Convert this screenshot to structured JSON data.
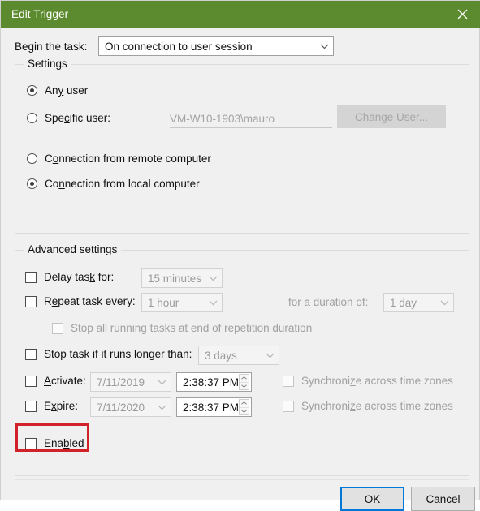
{
  "window": {
    "title": "Edit Trigger",
    "titlebar_color": "#5c8a2e",
    "close_icon": "close-icon"
  },
  "begin_task": {
    "label": "Begin the task:",
    "value": "On connection to user session"
  },
  "settings_group": {
    "title": "Settings",
    "radios": [
      {
        "label_pre": "An",
        "label_accel": "y",
        "label_post": " user",
        "checked": true
      },
      {
        "label_pre": "Spe",
        "label_accel": "c",
        "label_post": "ific user:",
        "checked": false
      },
      {
        "label_pre": "C",
        "label_accel": "o",
        "label_post": "nnection from remote computer",
        "checked": false
      },
      {
        "label_pre": "Co",
        "label_accel": "n",
        "label_post": "nection from local computer",
        "checked": true
      }
    ],
    "specific_user_value": "VM-W10-1903\\mauro",
    "change_user_button": {
      "pre": "Change ",
      "accel": "U",
      "post": "ser...",
      "enabled": false
    }
  },
  "advanced_group": {
    "title": "Advanced settings",
    "delay": {
      "pre": "Delay tas",
      "accel": "k",
      "post": " for:",
      "checked": false,
      "value": "15 minutes",
      "enabled": false
    },
    "repeat": {
      "pre": "R",
      "accel": "e",
      "post": "peat task every:",
      "checked": false,
      "value": "1 hour",
      "enabled": false,
      "duration_label_pre": "",
      "duration_label_accel": "f",
      "duration_label_post": "or a duration of:",
      "duration_value": "1 day"
    },
    "stop_repetition": {
      "pre": "Stop all running tasks at end of repetiti",
      "accel": "o",
      "post": "n duration",
      "checked": false,
      "enabled": false
    },
    "stop_longer": {
      "pre": "Stop task if it runs ",
      "accel": "l",
      "post": "onger than:",
      "checked": false,
      "value": "3 days",
      "enabled": false
    },
    "activate": {
      "pre": "",
      "accel": "A",
      "post": "ctivate:",
      "checked": false,
      "date": "7/11/2019",
      "time": "2:38:37 PM",
      "sync_pre": "Synchroni",
      "sync_accel": "z",
      "sync_post": "e across time zones",
      "sync_checked": false,
      "enabled": false
    },
    "expire": {
      "pre": "E",
      "accel": "x",
      "post": "pire:",
      "checked": false,
      "date": "7/11/2020",
      "time": "2:38:37 PM",
      "sync_pre": "Synchroni",
      "sync_accel": "z",
      "sync_post": "e across time zones",
      "sync_checked": false,
      "enabled": false
    }
  },
  "enabled_checkbox": {
    "pre": "Ena",
    "accel": "b",
    "post": "led",
    "checked": false,
    "highlight_color": "#d12229"
  },
  "footer": {
    "ok_label": "OK",
    "cancel_label": "Cancel"
  }
}
